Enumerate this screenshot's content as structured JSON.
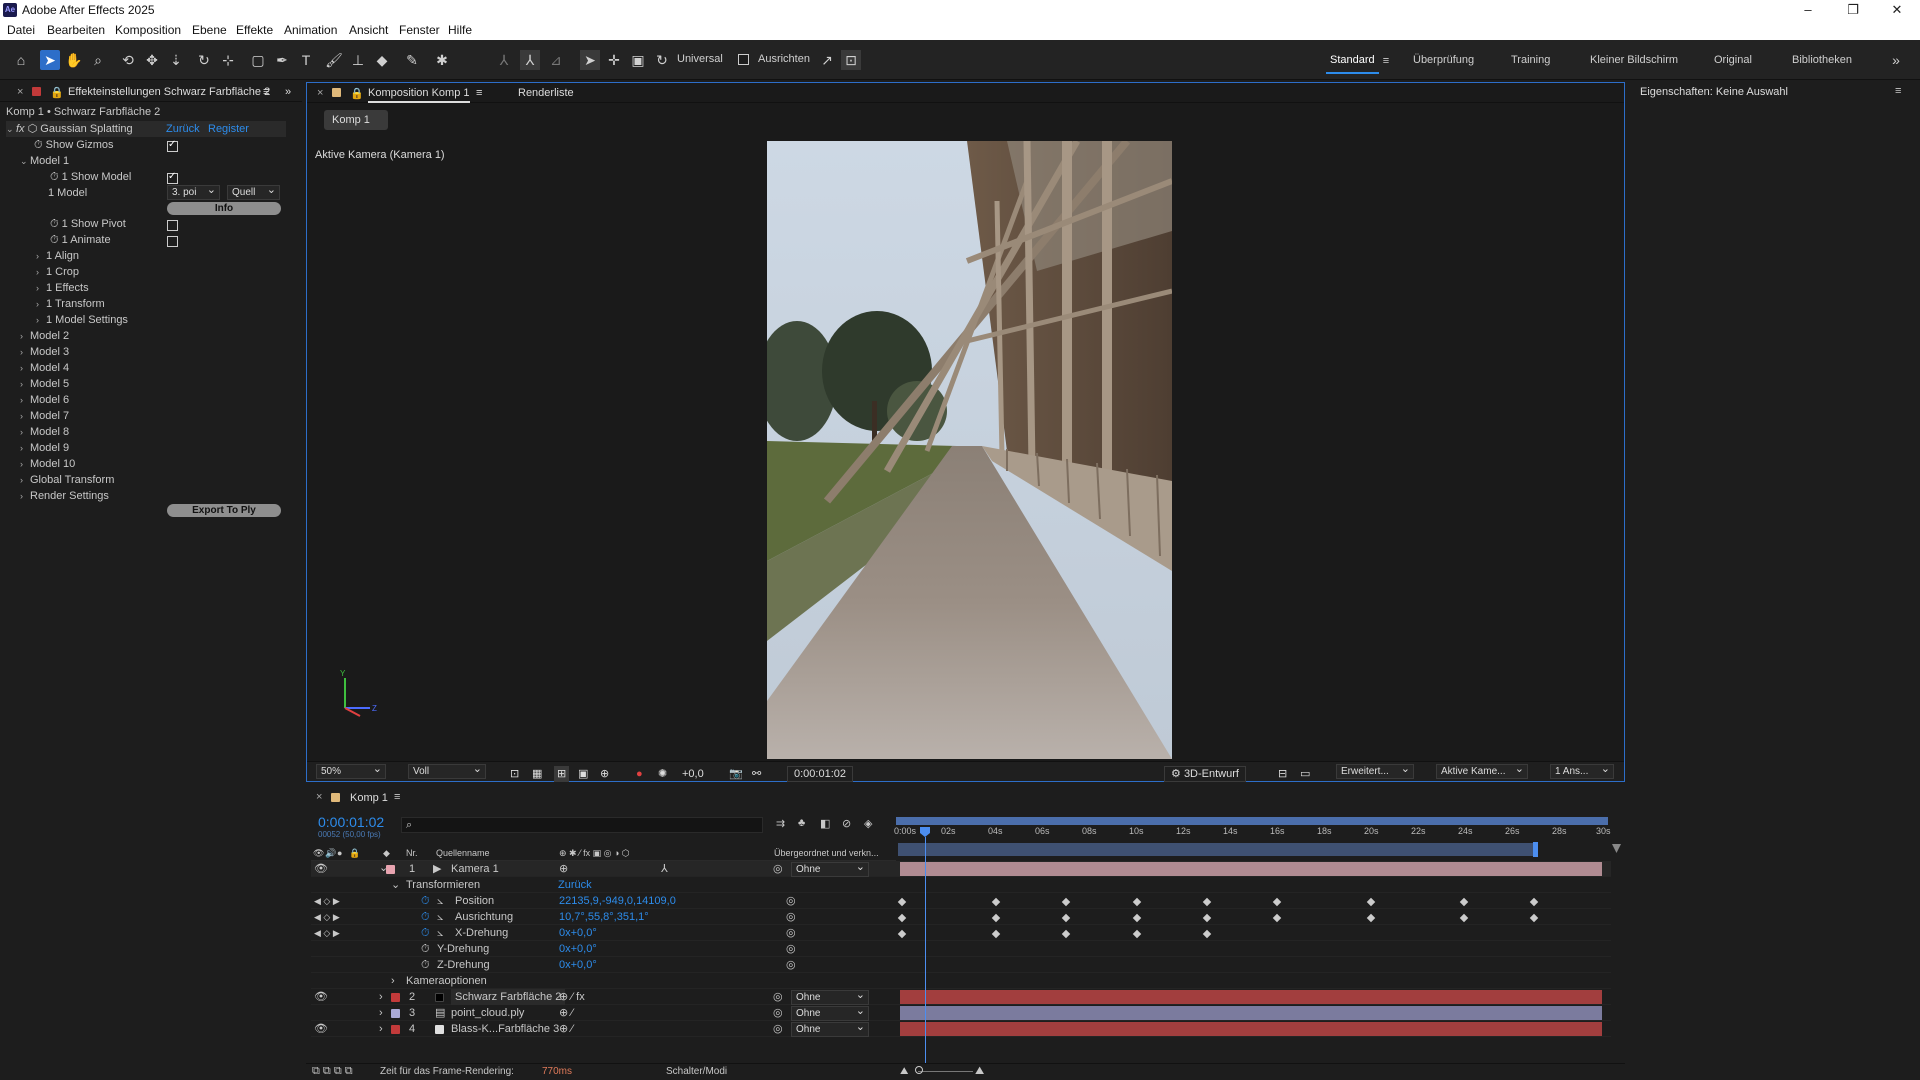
{
  "app": {
    "title": "Adobe After Effects 2025",
    "icon_label": "Ae"
  },
  "menu": [
    "Datei",
    "Bearbeiten",
    "Komposition",
    "Ebene",
    "Effekte",
    "Animation",
    "Ansicht",
    "Fenster",
    "Hilfe"
  ],
  "toolbar": {
    "universal_label": "Universal",
    "align_label": "Ausrichten"
  },
  "workspaces": [
    "Standard",
    "Überprüfung",
    "Training",
    "Kleiner Bildschirm",
    "Original",
    "Bibliotheken"
  ],
  "effects_panel": {
    "tab": "Effekteinstellungen Schwarz Farbfläche 2",
    "breadcrumb": "Komp 1 • Schwarz Farbfläche 2",
    "effect_name": "Gaussian Splatting",
    "reset": "Zurück",
    "register": "Register",
    "show_gizmos": "Show Gizmos",
    "model1": "Model 1",
    "show_model": "1 Show Model",
    "model_label": "1 Model",
    "model_select": "3. poi",
    "quelle_select": "Quell",
    "info_button": "Info",
    "show_pivot": "1 Show Pivot",
    "animate": "1 Animate",
    "groups": [
      "1 Align",
      "1 Crop",
      "1 Effects",
      "1 Transform",
      "1 Model Settings"
    ],
    "models": [
      "Model 2",
      "Model 3",
      "Model 4",
      "Model 5",
      "Model 6",
      "Model 7",
      "Model 8",
      "Model 9",
      "Model 10",
      "Global Transform",
      "Render Settings"
    ],
    "export_button": "Export To Ply"
  },
  "comp_panel": {
    "tab": "Komposition Komp 1",
    "render_tab": "Renderliste",
    "comp_button": "Komp 1",
    "camera_label": "Aktive Kamera (Kamera 1)",
    "zoom": "50%",
    "quality": "Voll",
    "exposure": "+0,0",
    "timecode": "0:00:01:02",
    "renderer": "3D-Entwurf",
    "extended": "Erweitert...",
    "camera_select": "Aktive Kame...",
    "views_select": "1 Ans..."
  },
  "properties_panel": {
    "title": "Eigenschaften: Keine Auswahl"
  },
  "timeline": {
    "tab": "Komp 1",
    "timecode": "0:00:01:02",
    "frames": "00052 (50,00 fps)",
    "col_nr": "Nr.",
    "col_source": "Quellenname",
    "col_parent": "Übergeordnet und verkn...",
    "ticks": [
      "0:00s",
      "02s",
      "04s",
      "06s",
      "08s",
      "10s",
      "12s",
      "14s",
      "16s",
      "18s",
      "20s",
      "22s",
      "24s",
      "26s",
      "28s",
      "30s"
    ],
    "layers": [
      {
        "nr": "1",
        "name": "Kamera 1",
        "parent": "Ohne",
        "color": "#e8a4b0"
      },
      {
        "nr": "2",
        "name": "Schwarz Farbfläche 2",
        "parent": "Ohne",
        "color": "#c23a3a"
      },
      {
        "nr": "3",
        "name": "point_cloud.ply",
        "parent": "Ohne",
        "color": "#a9a9d6"
      },
      {
        "nr": "4",
        "name": "Blass-K...Farbfläche 3",
        "parent": "Ohne",
        "color": "#c23a3a"
      }
    ],
    "transform_label": "Transformieren",
    "transform_reset": "Zurück",
    "props": [
      {
        "name": "Position",
        "value": "22135,9,-949,0,14109,0"
      },
      {
        "name": "Ausrichtung",
        "value": "10,7°,55,8°,351,1°"
      },
      {
        "name": "X-Drehung",
        "value": "0x+0,0°"
      },
      {
        "name": "Y-Drehung",
        "value": "0x+0,0°"
      },
      {
        "name": "Z-Drehung",
        "value": "0x+0,0°"
      }
    ],
    "camera_options": "Kameraoptionen",
    "footer_render_label": "Zeit für das Frame-Rendering:",
    "footer_render_value": "770ms",
    "footer_switches": "Schalter/Modi"
  }
}
